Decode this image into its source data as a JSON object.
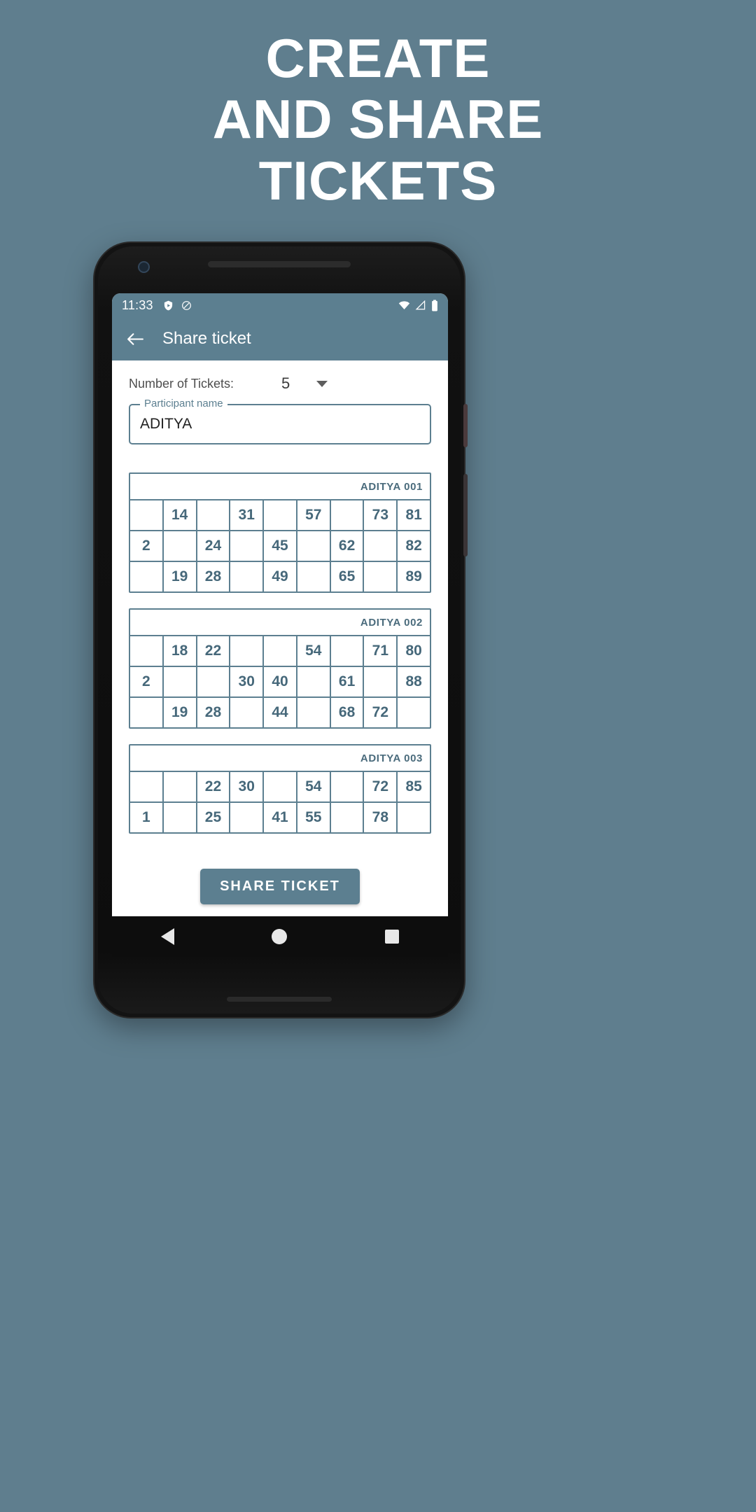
{
  "promo": {
    "headline_lines": [
      "CREATE",
      "AND SHARE",
      "TICKETS"
    ],
    "background_color": "#5f7e8e",
    "text_color": "#ffffff"
  },
  "device": {
    "frame_color": "#131313",
    "accent_color": "#5c7f90"
  },
  "status_bar": {
    "time": "11:33",
    "icons_left": [
      "shield-play-icon",
      "do-not-disturb-icon"
    ],
    "icons_right": [
      "wifi-icon",
      "signal-icon",
      "battery-icon"
    ]
  },
  "toolbar": {
    "back_icon": "arrow-back-icon",
    "title": "Share ticket"
  },
  "form": {
    "ticket_count_label": "Number of Tickets:",
    "ticket_count_value": "5",
    "ticket_count_caret": "chevron-down-icon",
    "participant_label": "Participant name",
    "participant_value": "ADITYA",
    "participant_placeholder": "Participant name"
  },
  "tickets": [
    {
      "id": "ADITYA 001",
      "rows": [
        [
          "",
          "14",
          "",
          "31",
          "",
          "57",
          "",
          "73",
          "81"
        ],
        [
          "2",
          "",
          "24",
          "",
          "45",
          "",
          "62",
          "",
          "82"
        ],
        [
          "",
          "19",
          "28",
          "",
          "49",
          "",
          "65",
          "",
          "89"
        ]
      ]
    },
    {
      "id": "ADITYA 002",
      "rows": [
        [
          "",
          "18",
          "22",
          "",
          "",
          "54",
          "",
          "71",
          "80"
        ],
        [
          "2",
          "",
          "",
          "30",
          "40",
          "",
          "61",
          "",
          "88"
        ],
        [
          "",
          "19",
          "28",
          "",
          "44",
          "",
          "68",
          "72",
          ""
        ]
      ]
    },
    {
      "id": "ADITYA 003",
      "rows": [
        [
          "",
          "",
          "22",
          "30",
          "",
          "54",
          "",
          "72",
          "85"
        ],
        [
          "1",
          "",
          "25",
          "",
          "41",
          "55",
          "",
          "78",
          ""
        ]
      ]
    }
  ],
  "share": {
    "button_label": "SHARE TICKET"
  },
  "nav_bar": {
    "items": [
      "nav-back-icon",
      "nav-home-icon",
      "nav-recents-icon"
    ]
  }
}
